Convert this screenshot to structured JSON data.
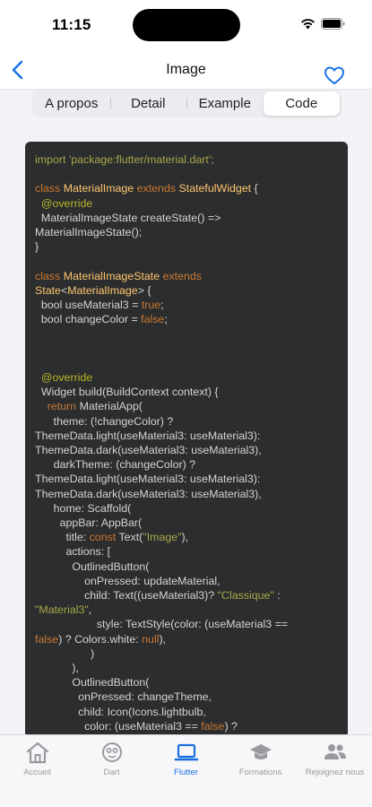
{
  "status_bar": {
    "time": "11:15"
  },
  "nav": {
    "title": "Image",
    "back_icon": "chevron-left-icon",
    "favorite_icon": "heart-icon",
    "accent": "#1a73e8"
  },
  "segmented": {
    "items": [
      "A propos",
      "Detail",
      "Example",
      "Code"
    ],
    "selected": "Code"
  },
  "code": {
    "lines": [
      [
        [
          "str",
          "import 'package:flutter/material.dart';"
        ]
      ],
      [],
      [
        [
          "kw",
          "class "
        ],
        [
          "cls",
          "MaterialImage "
        ],
        [
          "kw",
          "extends "
        ],
        [
          "cls",
          "StatefulWidget"
        ],
        [
          "txt",
          " {"
        ]
      ],
      [
        [
          "ann",
          "  @override"
        ]
      ],
      [
        [
          "txt",
          "  MaterialImageState createState() =>"
        ]
      ],
      [
        [
          "txt",
          "MaterialImageState();"
        ]
      ],
      [
        [
          "txt",
          "}"
        ]
      ],
      [],
      [
        [
          "kw",
          "class "
        ],
        [
          "cls",
          "MaterialImageState "
        ],
        [
          "kw",
          "extends"
        ]
      ],
      [
        [
          "cls",
          "State"
        ],
        [
          "txt",
          "<"
        ],
        [
          "cls",
          "MaterialImage"
        ],
        [
          "txt",
          "> {"
        ]
      ],
      [
        [
          "txt",
          "  bool useMaterial3 = "
        ],
        [
          "kw",
          "true"
        ],
        [
          "txt",
          ";"
        ]
      ],
      [
        [
          "txt",
          "  bool changeColor = "
        ],
        [
          "kw",
          "false"
        ],
        [
          "txt",
          ";"
        ]
      ],
      [],
      [],
      [],
      [
        [
          "ann",
          "  @override"
        ]
      ],
      [
        [
          "txt",
          "  Widget build(BuildContext context) {"
        ]
      ],
      [
        [
          "kw",
          "    return "
        ],
        [
          "txt",
          "MaterialApp("
        ]
      ],
      [
        [
          "txt",
          "      theme: (!changeColor) ?"
        ]
      ],
      [
        [
          "txt",
          "ThemeData.light(useMaterial3: useMaterial3):"
        ]
      ],
      [
        [
          "txt",
          "ThemeData.dark(useMaterial3: useMaterial3),"
        ]
      ],
      [
        [
          "txt",
          "      darkTheme: (changeColor) ?"
        ]
      ],
      [
        [
          "txt",
          "ThemeData.light(useMaterial3: useMaterial3):"
        ]
      ],
      [
        [
          "txt",
          "ThemeData.dark(useMaterial3: useMaterial3),"
        ]
      ],
      [
        [
          "txt",
          "      home: Scaffold("
        ]
      ],
      [
        [
          "txt",
          "        appBar: AppBar("
        ]
      ],
      [
        [
          "txt",
          "          title: "
        ],
        [
          "kw",
          "const "
        ],
        [
          "txt",
          "Text("
        ],
        [
          "str",
          "\"Image\""
        ],
        [
          "txt",
          "),"
        ]
      ],
      [
        [
          "txt",
          "          actions: ["
        ]
      ],
      [
        [
          "txt",
          "            OutlinedButton("
        ]
      ],
      [
        [
          "txt",
          "                onPressed: updateMaterial,"
        ]
      ],
      [
        [
          "txt",
          "                child: Text((useMaterial3)? "
        ],
        [
          "str",
          "\"Classique\""
        ],
        [
          "txt",
          " :"
        ]
      ],
      [
        [
          "str",
          "\"Material3\""
        ],
        [
          "txt",
          ","
        ]
      ],
      [
        [
          "txt",
          "                    style: TextStyle(color: (useMaterial3 =="
        ]
      ],
      [
        [
          "kw",
          "false"
        ],
        [
          "txt",
          ") ? Colors.white: "
        ],
        [
          "kw",
          "null"
        ],
        [
          "txt",
          "),"
        ]
      ],
      [
        [
          "txt",
          "                  )"
        ]
      ],
      [
        [
          "txt",
          "            ),"
        ]
      ],
      [
        [
          "txt",
          "            OutlinedButton("
        ]
      ],
      [
        [
          "txt",
          "              onPressed: changeTheme,"
        ]
      ],
      [
        [
          "txt",
          "              child: Icon(Icons.lightbulb,"
        ]
      ],
      [
        [
          "txt",
          "                color: (useMaterial3 == "
        ],
        [
          "kw",
          "false"
        ],
        [
          "txt",
          ") ?"
        ]
      ]
    ]
  },
  "tabs": [
    {
      "label": "Accueil",
      "icon": "home-icon"
    },
    {
      "label": "Dart",
      "icon": "dart-icon"
    },
    {
      "label": "Flutter",
      "icon": "laptop-icon",
      "active": true
    },
    {
      "label": "Formations",
      "icon": "graduation-cap-icon"
    },
    {
      "label": "Rejoignez nous",
      "icon": "people-icon"
    }
  ]
}
